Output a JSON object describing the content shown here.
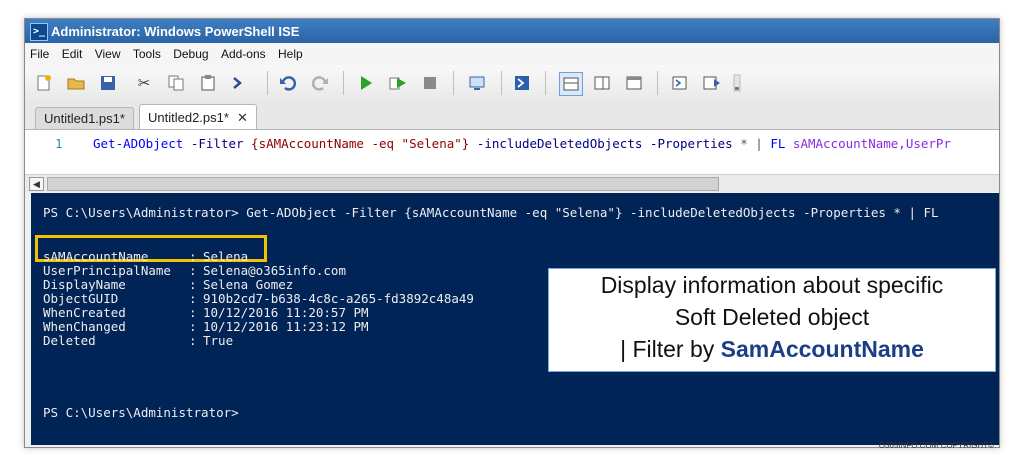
{
  "window": {
    "title": "Administrator: Windows PowerShell ISE"
  },
  "menu": [
    "File",
    "Edit",
    "View",
    "Tools",
    "Debug",
    "Add-ons",
    "Help"
  ],
  "tabs": [
    {
      "label": "Untitled1.ps1*"
    },
    {
      "label": "Untitled2.ps1*",
      "close": "✕"
    }
  ],
  "editor": {
    "line_number": "1",
    "code": {
      "cmd": "Get-ADObject",
      "p1": " -Filter ",
      "filter": "{sAMAccountName -eq \"Selena\"}",
      "p2": " -includeDeletedObjects -Properties ",
      "star": "*",
      "pipe": " | ",
      "fl": "FL",
      "props": " sAMAccountName,UserPr"
    }
  },
  "console": {
    "command_line": "PS C:\\Users\\Administrator> Get-ADObject -Filter {sAMAccountName -eq \"Selena\"} -includeDeletedObjects -Properties * | FL",
    "properties": [
      {
        "key": "sAMAccountName",
        "value": "Selena"
      },
      {
        "key": "UserPrincipalName",
        "value": "Selena@o365info.com"
      },
      {
        "key": "DisplayName",
        "value": "Selena Gomez"
      },
      {
        "key": "ObjectGUID",
        "value": "910b2cd7-b638-4c8c-a265-fd3892c48a49"
      },
      {
        "key": "WhenCreated",
        "value": "10/12/2016 11:20:57 PM"
      },
      {
        "key": "WhenChanged",
        "value": "10/12/2016 11:23:12 PM"
      },
      {
        "key": "Deleted",
        "value": "True"
      }
    ],
    "separator": ":",
    "prompt": "PS C:\\Users\\Administrator>"
  },
  "callout": {
    "line1": "Display information about specific",
    "line2": "Soft Deleted object",
    "line3_prefix": "| Filter by ",
    "line3_bold": "SamAccountName"
  },
  "copyright": "O365INFO.COM COPYRIGHT©",
  "colors": {
    "console_bg": "#012456",
    "highlight": "#f2c200",
    "title_bar": "#2b63a6"
  }
}
